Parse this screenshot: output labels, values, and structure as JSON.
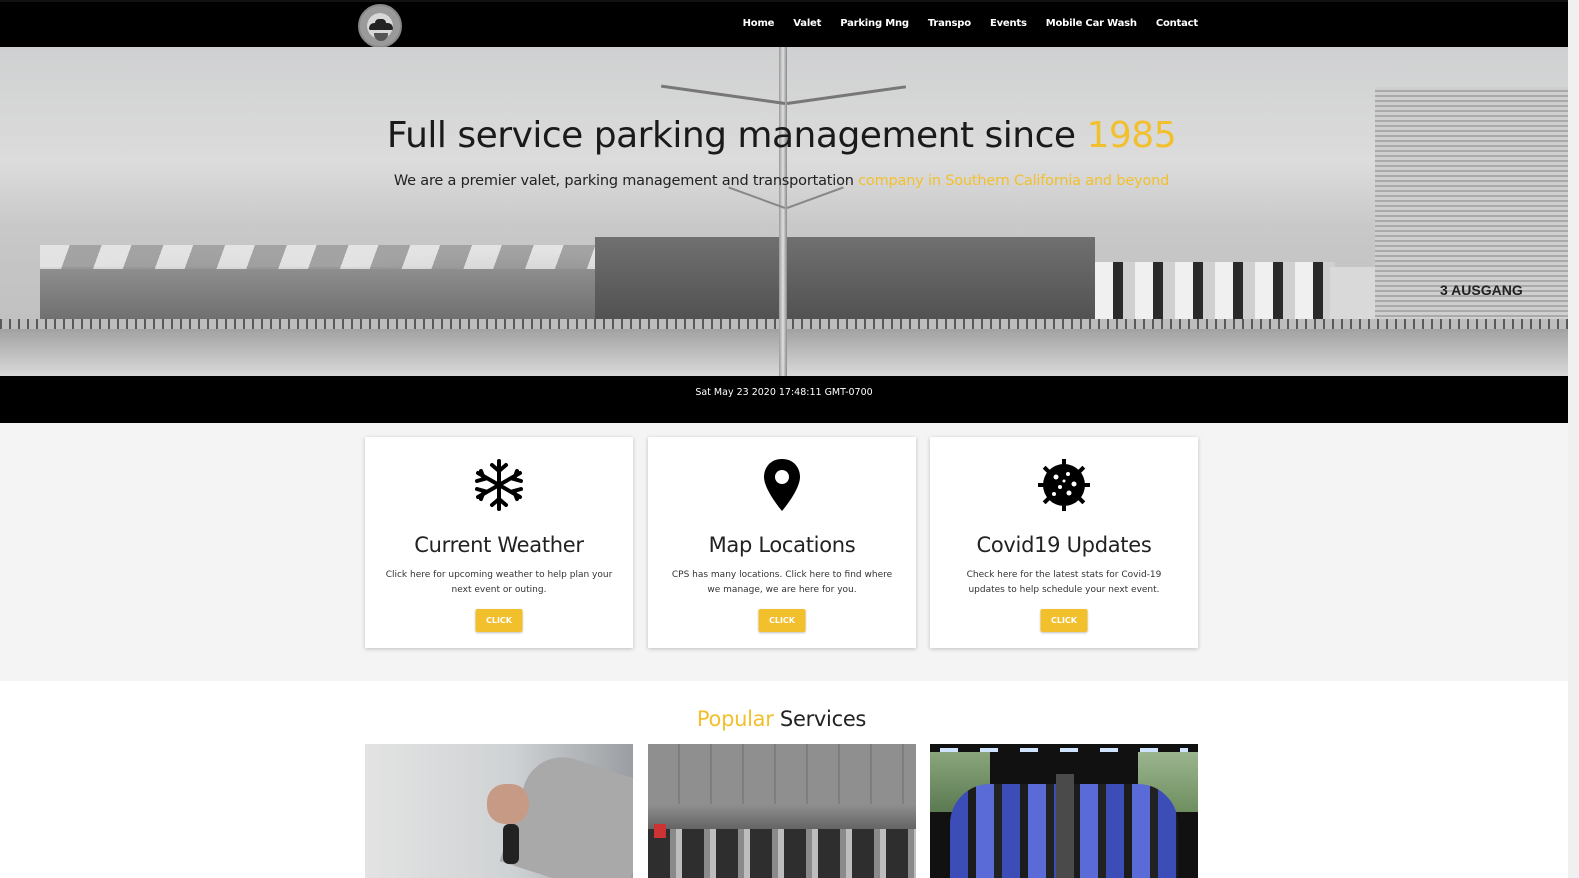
{
  "nav": {
    "logo_icon": "valet-car-logo-icon",
    "links": [
      "Home",
      "Valet",
      "Parking Mng",
      "Transpo",
      "Events",
      "Mobile Car Wash",
      "Contact"
    ]
  },
  "hero": {
    "title_main": "Full service parking management since ",
    "title_accent": "1985",
    "subtitle_main": "We are a premier valet, parking management and transportation ",
    "subtitle_accent": "company in Southern California and beyond",
    "sign_text": "3 AUSGANG"
  },
  "datebar": {
    "text": "Sat May 23 2020 17:48:11 GMT-0700"
  },
  "cards": [
    {
      "icon": "snowflake-icon",
      "title": "Current Weather",
      "text": "Click here for upcoming weather to help plan your next event or outing.",
      "button": "CLICK"
    },
    {
      "icon": "map-pin-icon",
      "title": "Map Locations",
      "text": "CPS has many locations. Click here to find where we manage, we are here for you.",
      "button": "CLICK"
    },
    {
      "icon": "virus-icon",
      "title": "Covid19 Updates",
      "text": "Check here for the latest stats for Covid-19 updates to help schedule your next event.",
      "button": "CLICK"
    }
  ],
  "popular": {
    "title_accent": "Popular",
    "title_main": " Services",
    "services": [
      "valet-key-hand-image",
      "parking-garage-image",
      "bus-interior-image"
    ]
  },
  "colors": {
    "accent": "#f2c02d",
    "nav_bg": "#000000"
  }
}
